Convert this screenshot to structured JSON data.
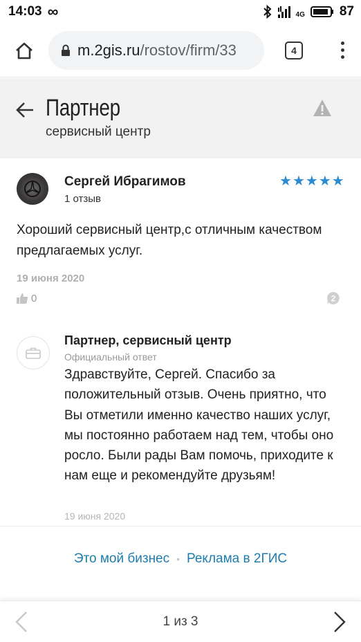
{
  "status_bar": {
    "time": "14:03",
    "infinity": "∞",
    "network": "4G",
    "battery": "87"
  },
  "browser": {
    "url_host": "m.2gis.ru",
    "url_path": "/rostov/firm/33",
    "tab_count": "4"
  },
  "header": {
    "title": "Партнер",
    "subtitle": "сервисный центр"
  },
  "review": {
    "author": "Сергей Ибрагимов",
    "reviews_count": "1 отзыв",
    "rating": 5,
    "stars": "★★★★★",
    "text": "Хороший сервисный центр,с отличным качеством предлагаемых услуг.",
    "date": "19 июня 2020",
    "likes": "0",
    "comments": "2"
  },
  "reply": {
    "author": "Партнер, сервисный центр",
    "label": "Официальный ответ",
    "text": "Здравствуйте, Сергей. Спасибо за положительный отзыв. Очень приятно, что Вы отметили именно качество наших услуг, мы постоянно работаем над тем, чтобы оно росло. Были рады Вам помочь, приходите к нам еще и рекомендуйте друзьям!",
    "date": "19 июня 2020"
  },
  "footer": {
    "my_business": "Это мой бизнес",
    "separator": "•",
    "ads": "Реклама в 2ГИС"
  },
  "pager": {
    "text": "1 из 3"
  },
  "colors": {
    "star": "#2a8bd0",
    "link": "#1f7cac",
    "header_bg": "#f2f2f2"
  }
}
